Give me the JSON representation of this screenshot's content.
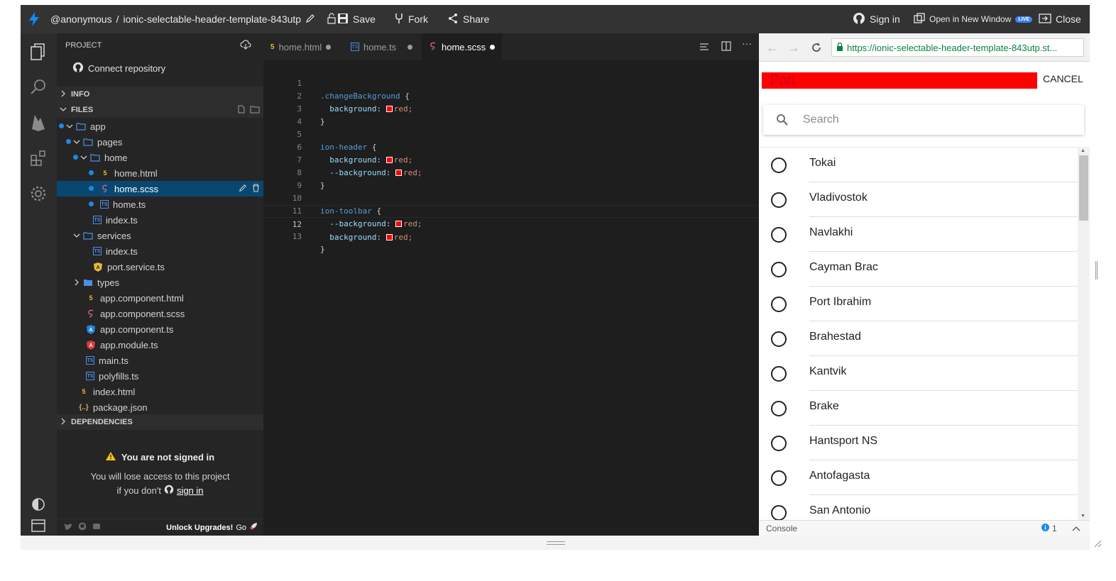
{
  "topbar": {
    "user": "@anonymous",
    "separator": "/",
    "project_name": "ionic-selectable-header-template-843utp",
    "save_label": "Save",
    "fork_label": "Fork",
    "share_label": "Share",
    "sign_in_label": "Sign in",
    "open_window_label": "Open in New Window",
    "live_badge": "LIVE",
    "close_label": "Close"
  },
  "sidebar": {
    "project_label": "PROJECT",
    "connect_repo": "Connect repository",
    "info_label": "INFO",
    "files_label": "FILES",
    "tree": [
      {
        "name": "app",
        "type": "folder",
        "open": true
      },
      {
        "name": "pages",
        "type": "folder",
        "open": true
      },
      {
        "name": "home",
        "type": "folder",
        "open": true
      },
      {
        "name": "home.html",
        "type": "html"
      },
      {
        "name": "home.scss",
        "type": "scss"
      },
      {
        "name": "home.ts",
        "type": "ts"
      },
      {
        "name": "index.ts",
        "type": "ts"
      },
      {
        "name": "services",
        "type": "folder",
        "open": true
      },
      {
        "name": "index.ts",
        "type": "ts"
      },
      {
        "name": "port.service.ts",
        "type": "angular"
      },
      {
        "name": "types",
        "type": "folder",
        "open": false
      },
      {
        "name": "app.component.html",
        "type": "html"
      },
      {
        "name": "app.component.scss",
        "type": "scss"
      },
      {
        "name": "app.component.ts",
        "type": "angular"
      },
      {
        "name": "app.module.ts",
        "type": "angular-red"
      },
      {
        "name": "main.ts",
        "type": "ts"
      },
      {
        "name": "polyfills.ts",
        "type": "ts"
      },
      {
        "name": "index.html",
        "type": "html"
      },
      {
        "name": "package.json",
        "type": "json"
      }
    ],
    "dependencies_label": "DEPENDENCIES",
    "not_signed_in": "You are not signed in",
    "lose_access_line1": "You will lose access to this project",
    "lose_access_line2": "if you don't",
    "sign_in_link": "sign in",
    "unlock_label": "Unlock Upgrades!",
    "go_label": "Go"
  },
  "editor": {
    "tabs": [
      {
        "label": "home.html",
        "icon": "html5-icon"
      },
      {
        "label": "home.ts",
        "icon": "ts-icon"
      },
      {
        "label": "home.scss",
        "icon": "sass-icon"
      }
    ],
    "lines": [
      {
        "n": "1",
        "sel": ".changeBackground",
        "brace": " {"
      },
      {
        "n": "2",
        "prop": "  background:",
        "val": "red;"
      },
      {
        "n": "3",
        "brace": "}"
      },
      {
        "n": "4"
      },
      {
        "n": "5",
        "sel": "ion-header",
        "brace": " {"
      },
      {
        "n": "6",
        "prop": "  background:",
        "val": "red;"
      },
      {
        "n": "7",
        "prop": "  --background:",
        "val": "red;"
      },
      {
        "n": "8",
        "brace": "}"
      },
      {
        "n": "9"
      },
      {
        "n": "10",
        "sel": "ion-toolbar",
        "brace": " {"
      },
      {
        "n": "11",
        "prop": "  --background:",
        "val": "red;"
      },
      {
        "n": "12",
        "prop": "  background:",
        "val": "red;"
      },
      {
        "n": "13",
        "brace": "}"
      }
    ]
  },
  "preview": {
    "url": "https://ionic-selectable-header-template-843utp.st...",
    "header_title": "Port",
    "cancel_label": "CANCEL",
    "search_placeholder": "Search",
    "items": [
      "Tokai",
      "Vladivostok",
      "Navlakhi",
      "Cayman Brac",
      "Port Ibrahim",
      "Brahestad",
      "Kantvik",
      "Brake",
      "Hantsport NS",
      "Antofagasta",
      "San Antonio"
    ],
    "console_label": "Console",
    "console_count": "1"
  },
  "colors": {
    "accent": "#1e88e5",
    "header_red": "#ff0000",
    "selected_row": "#094771"
  }
}
